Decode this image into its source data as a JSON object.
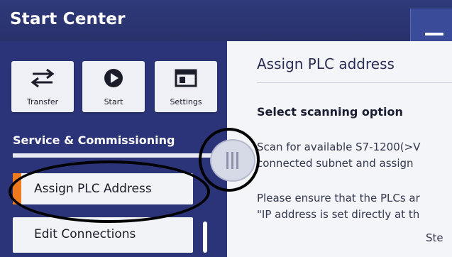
{
  "window": {
    "title": "Start Center"
  },
  "toolbar": {
    "tiles": [
      {
        "label": "Transfer",
        "icon": "transfer-arrows-icon"
      },
      {
        "label": "Start",
        "icon": "play-icon"
      },
      {
        "label": "Settings",
        "icon": "settings-panel-icon"
      }
    ]
  },
  "sidebar": {
    "section_title": "Service & Commissioning",
    "items": [
      {
        "label": "Assign PLC Address",
        "selected": true
      },
      {
        "label": "Edit Connections",
        "selected": false
      }
    ]
  },
  "main": {
    "heading": "Assign PLC address",
    "subheading": "Select scanning option",
    "paragraph1_line1": "Scan for available S7-1200(>V",
    "paragraph1_line2": "connected subnet and assign",
    "paragraph2_line1": "Please ensure that the PLCs ar",
    "paragraph2_line2": "\"IP address is set directly at th",
    "footer_fragment": "Ste"
  },
  "colors": {
    "title_bar": "#2e3a7a",
    "left_panel": "#2b3478",
    "accent": "#f07a1e",
    "right_panel": "#f4f5f9"
  }
}
